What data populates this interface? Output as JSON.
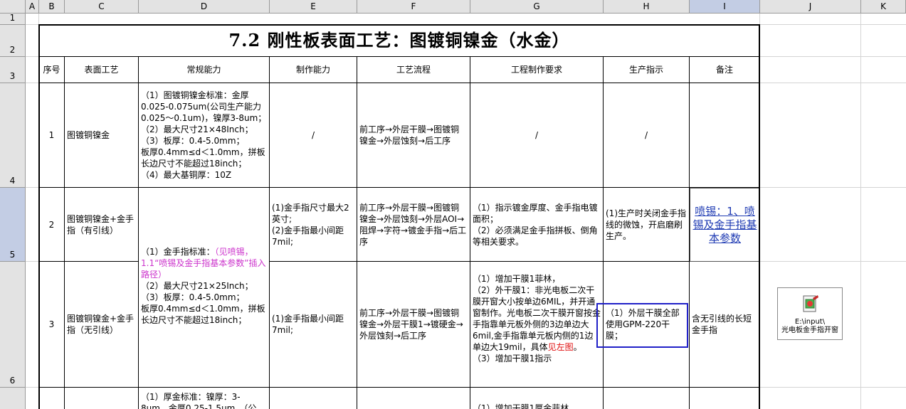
{
  "columns": [
    "A",
    "B",
    "C",
    "D",
    "E",
    "F",
    "G",
    "H",
    "I",
    "J",
    "K"
  ],
  "selected_column": "I",
  "rows": [
    "1",
    "2",
    "3",
    "4",
    "5",
    "6"
  ],
  "selected_row": "5",
  "title": "7.2 刚性板表面工艺：图镀铜镍金（水金）",
  "headers": [
    "序号",
    "表面工艺",
    "常规能力",
    "制作能力",
    "工艺流程",
    "工程制作要求",
    "生产指示",
    "备注"
  ],
  "row1": {
    "no": "1",
    "process": "图镀铜镍金",
    "normal_capability": "（1）图镀铜镍金标准：金厚0.025-0.075um(公司生产能力0.025～0.1um)，镍厚3-8um；\n（2）最大尺寸21×48Inch；\n（3）板厚：0.4-5.0mm；\n板厚0.4mm≤d＜1.0mm，拼板长边尺寸不能超过18inch；\n（4）最大基铜厚：10Z",
    "capability": "/",
    "flow": "前工序→外层干膜→图镀铜镍金→外层蚀刻→后工序",
    "engineering": "/",
    "production": "/",
    "remark": ""
  },
  "row2": {
    "no": "2",
    "process": "图镀铜镍金+金手指（有引线）",
    "capability": "(1)金手指尺寸最大2英寸;\n(2)金手指最小间距7mil;",
    "flow": "前工序→外层干膜→图镀铜镍金→外层蚀刻→外层AOI→阻焊→字符→镀金手指→后工序",
    "engineering": "（1）指示镀金厚度、金手指电镀面积；\n（2）必须满足金手指拼板、倒角等相关要求。",
    "production": "(1)生产时关闭金手指线的微蚀，开启磨刷生产。",
    "remark_link": "喷锡：1、喷锡及金手指基本参数"
  },
  "merged_normal_capability": {
    "line1": "（1）金手指标准：",
    "magenta": "（见喷锡，1.1“喷锡及金手指基本参数”插入路径）",
    "rest": "\n（2）最大尺寸21×25Inch；\n（3）板厚：0.4-5.0mm；\n板厚0.4mm≤d＜1.0mm，拼板长边尺寸不能超过18inch；"
  },
  "row3": {
    "no": "3",
    "process": "图镀铜镍金+金手指（无引线）",
    "capability": "(1)金手指最小间距7mil;",
    "flow": "前工序→外层干膜→图镀铜镍金→外层干膜1→镀硬金→外层蚀刻→后工序",
    "engineering_a": "（1）增加干膜1菲林，\n（2）外干膜1：非光电板二次干膜开窗大小按单边6MIL，并开通窗制作。光电板二次干膜开窗按金手指靠单元板外侧的3边单边大6mil,金手指靠单元板内侧的1边单边大19mil，具体",
    "engineering_red": "见左图",
    "engineering_b": "。\n（3）增加干膜1指示",
    "production": "（1）外层干膜全部使用GPM-220干膜；",
    "remark": "含无引线的长短金手指"
  },
  "row4_partial": {
    "normal_capability": "（1）厚金标准：镍厚：3-8um，金厚0.25-1.5um，（公",
    "engineering": "（1）增加干膜1厚金菲林"
  },
  "embedded_object": {
    "icon": "package-object-icon",
    "caption": "E:\\input\\\n光电板金手指开窗"
  }
}
